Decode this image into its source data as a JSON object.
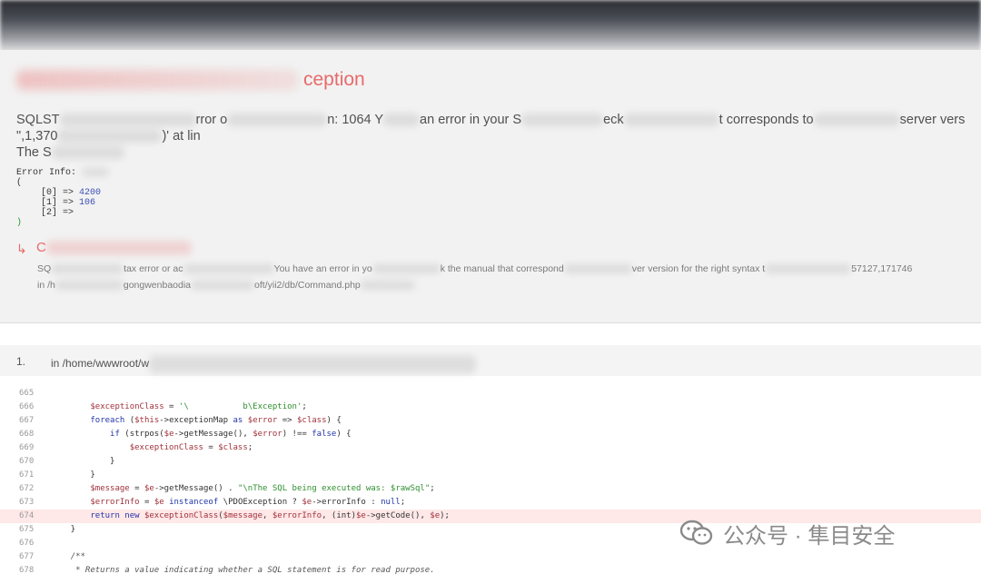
{
  "header": {
    "exception_title_visible": "ception",
    "message_line1": [
      "SQLST",
      "rror o",
      "n: 1064 Y",
      "an error in your S",
      "eck",
      "t corresponds to",
      "server vers"
    ],
    "message_line2": [
      "\",1,370",
      ")' at lin"
    ],
    "message_line3": [
      "The S"
    ]
  },
  "error_info": {
    "label": "Error Info:",
    "open": "(",
    "rows": [
      {
        "key": "[0] =>",
        "value": "4200"
      },
      {
        "key": "[1] =>",
        "value": "106"
      },
      {
        "key": "[2] =>",
        "value": ""
      }
    ],
    "close": ")"
  },
  "previous_exception": {
    "arrow": "↳",
    "title": "C",
    "line1_parts": [
      "SQ",
      "tax error or ac",
      "You have an error in yo",
      "k the manual that correspond",
      "ver version for the right syntax t",
      "57127,171746"
    ],
    "line2_parts": [
      "in /h",
      "gongwenbaodia",
      "oft/yii2/db/Command.php"
    ]
  },
  "frame": {
    "index": "1.",
    "path": "in /home/wwwroot/w"
  },
  "code": {
    "highlight_line": "674",
    "lines": [
      {
        "n": "665",
        "html": ""
      },
      {
        "n": "666",
        "html": "        <span class=\"var\">$exceptionClass</span> = <span class=\"str\">'\\           b\\Exception'</span>;"
      },
      {
        "n": "667",
        "html": "        <span class=\"kw\">foreach</span> (<span class=\"var\">$this</span>->exceptionMap <span class=\"kw\">as</span> <span class=\"var\">$error</span> => <span class=\"var\">$class</span>) {"
      },
      {
        "n": "668",
        "html": "            <span class=\"kw\">if</span> (strpos(<span class=\"var\">$e</span>->getMessage(), <span class=\"var\">$error</span>) !== <span class=\"kw\">false</span>) {"
      },
      {
        "n": "669",
        "html": "                <span class=\"var\">$exceptionClass</span> = <span class=\"var\">$class</span>;"
      },
      {
        "n": "670",
        "html": "            }"
      },
      {
        "n": "671",
        "html": "        }"
      },
      {
        "n": "672",
        "html": "        <span class=\"var\">$message</span> = <span class=\"var\">$e</span>->getMessage() . <span class=\"str\">\"\\nThe SQL being executed was: $rawSql\"</span>;"
      },
      {
        "n": "673",
        "html": "        <span class=\"var\">$errorInfo</span> = <span class=\"var\">$e</span> <span class=\"kw\">instanceof</span> \\PDOException ? <span class=\"var\">$e</span>->errorInfo : <span class=\"kw\">null</span>;"
      },
      {
        "n": "674",
        "html": "        <span class=\"kw\">return new</span> <span class=\"var\">$exceptionClass</span>(<span class=\"var\">$message</span>, <span class=\"var\">$errorInfo</span>, (int)<span class=\"var\">$e</span>->getCode(), <span class=\"var\">$e</span>);"
      },
      {
        "n": "675",
        "html": "    }"
      },
      {
        "n": "676",
        "html": ""
      },
      {
        "n": "677",
        "html": "    <span class=\"cm\">/**</span>"
      },
      {
        "n": "678",
        "html": "     <span class=\"cm\">* Returns a value indicating whether a SQL statement is for read purpose.</span>"
      }
    ]
  },
  "watermark": {
    "text": "公众号 · 隼目安全",
    "icon": "wechat-icon"
  },
  "colors": {
    "exception_red": "#e86a6a",
    "highlight_bg": "#ffe8e8",
    "variable": "#a0323c",
    "string": "#2f8f2f",
    "keyword": "#2236a8"
  }
}
